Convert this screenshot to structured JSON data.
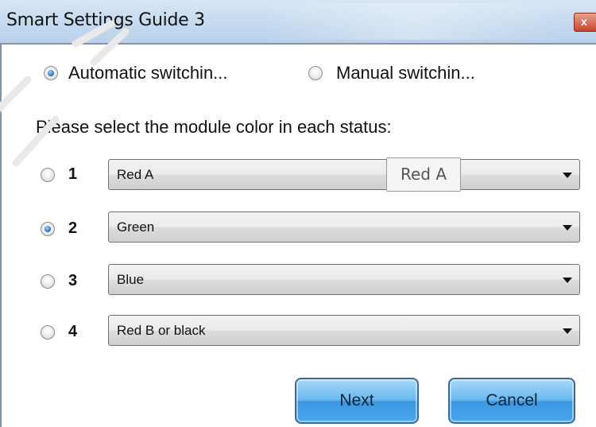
{
  "window": {
    "title": "Smart Settings Guide 3",
    "close_glyph": "x"
  },
  "mode": {
    "automatic_label": "Automatic switchin...",
    "automatic_selected": true,
    "manual_label": "Manual switchin...",
    "manual_selected": false
  },
  "prompt": "Please select the module color in each status:",
  "statuses": [
    {
      "number": "1",
      "selected": false,
      "color_value": "Red A"
    },
    {
      "number": "2",
      "selected": true,
      "color_value": "Green"
    },
    {
      "number": "3",
      "selected": false,
      "color_value": "Blue"
    },
    {
      "number": "4",
      "selected": false,
      "color_value": "Red B or black"
    }
  ],
  "tooltip": "Red A",
  "buttons": {
    "next_label": "Next",
    "cancel_label": "Cancel"
  },
  "colors": {
    "titlebar": "#c5daef",
    "frame_border": "#7f93ad",
    "button_blue": "#6ab8ee",
    "close_red": "#c5472c"
  }
}
